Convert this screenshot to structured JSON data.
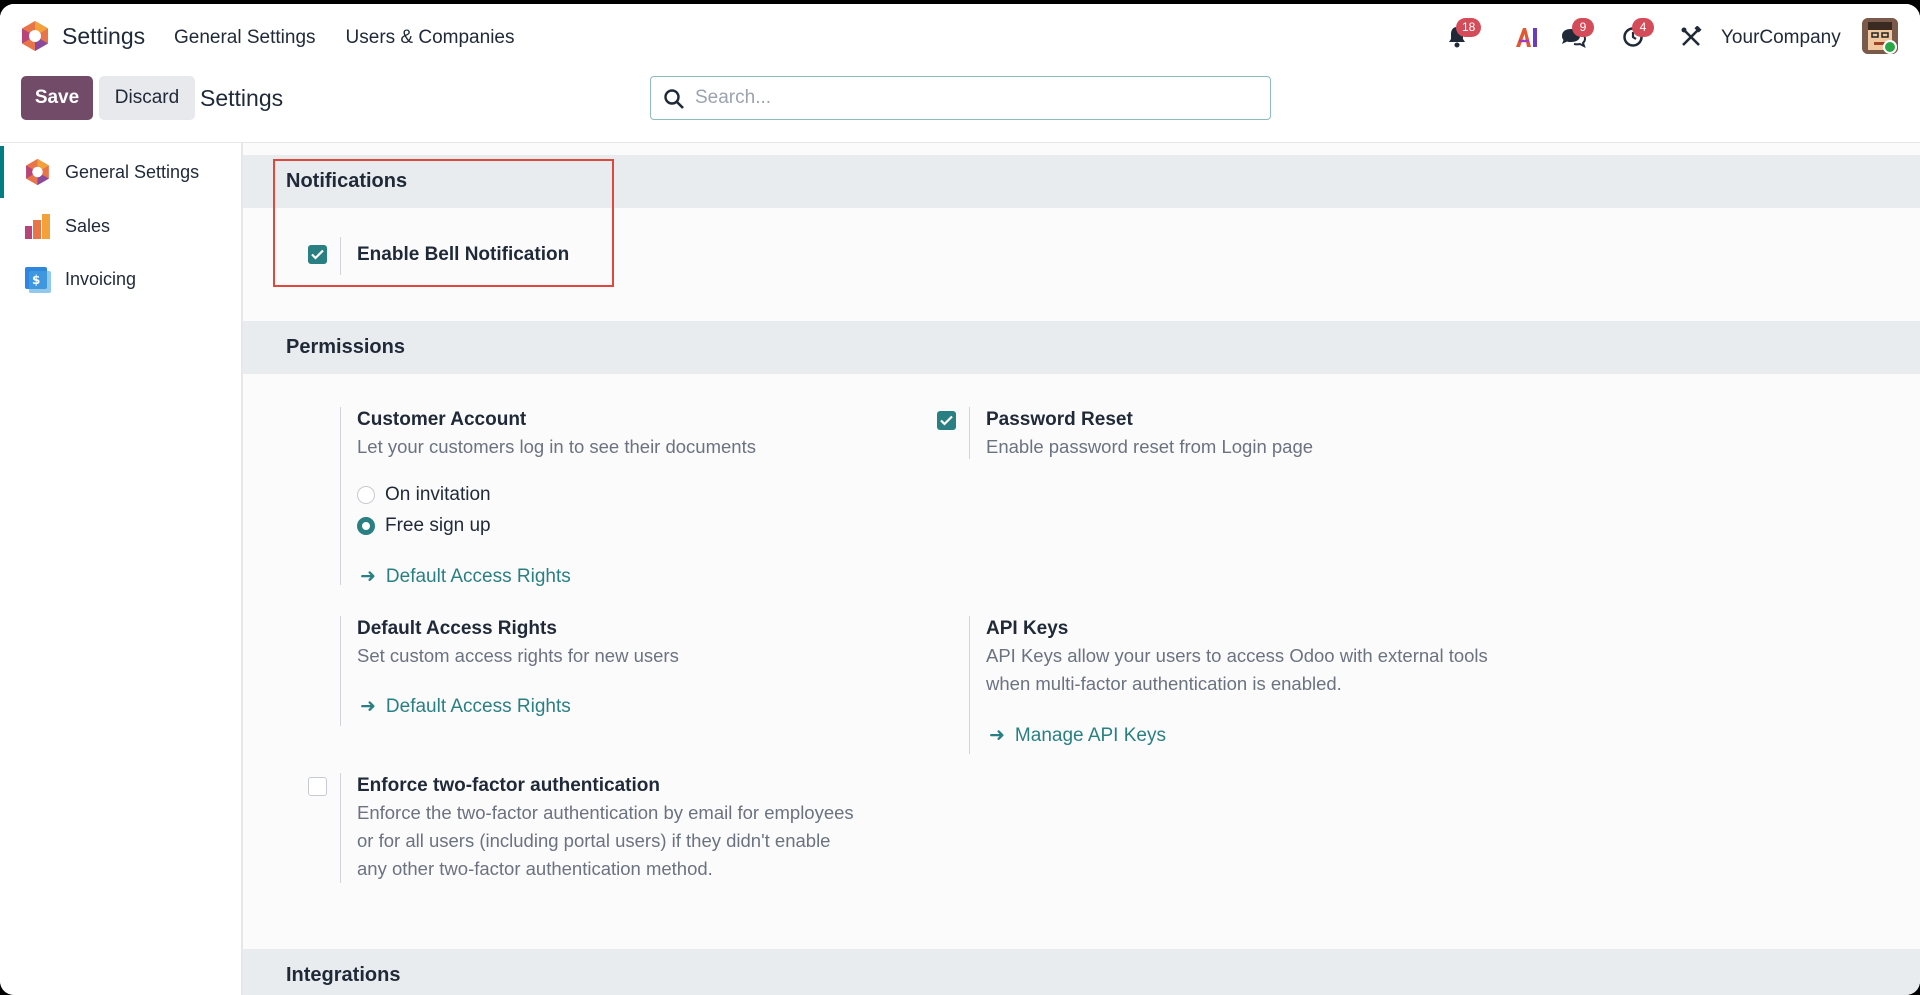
{
  "navbar": {
    "app_title": "Settings",
    "menu": [
      "General Settings",
      "Users & Companies"
    ],
    "badges": {
      "notifications": "18",
      "messages": "9",
      "activities": "4"
    },
    "company": "YourCompany"
  },
  "control_panel": {
    "save_label": "Save",
    "discard_label": "Discard",
    "title": "Settings",
    "search_placeholder": "Search..."
  },
  "sidebar": {
    "items": [
      {
        "label": "General Settings",
        "active": true
      },
      {
        "label": "Sales",
        "active": false
      },
      {
        "label": "Invoicing",
        "active": false
      }
    ]
  },
  "sections": {
    "notifications": {
      "title": "Notifications",
      "enable_bell": {
        "label": "Enable Bell Notification",
        "checked": true
      }
    },
    "permissions": {
      "title": "Permissions",
      "customer_account": {
        "title": "Customer Account",
        "desc": "Let your customers log in to see their documents",
        "options": [
          "On invitation",
          "Free sign up"
        ],
        "selected": "Free sign up",
        "link": "Default Access Rights"
      },
      "password_reset": {
        "title": "Password Reset",
        "desc": "Enable password reset from Login page",
        "checked": true
      },
      "default_access": {
        "title": "Default Access Rights",
        "desc": "Set custom access rights for new users",
        "link": "Default Access Rights"
      },
      "api_keys": {
        "title": "API Keys",
        "desc_line1": "API Keys allow your users to access Odoo with external tools",
        "desc_line2": "when multi-factor authentication is enabled.",
        "link": "Manage API Keys"
      },
      "two_factor": {
        "title": "Enforce two-factor authentication",
        "desc_line1": "Enforce the two-factor authentication by email for employees",
        "desc_line2": "or for all users (including portal users) if they didn't enable",
        "desc_line3": "any other two-factor authentication method.",
        "checked": false
      }
    },
    "integrations": {
      "title": "Integrations"
    }
  },
  "colors": {
    "brand": "#714b67",
    "accent": "#2a7f82",
    "badge": "#d44c59",
    "highlight": "#e0483e"
  }
}
